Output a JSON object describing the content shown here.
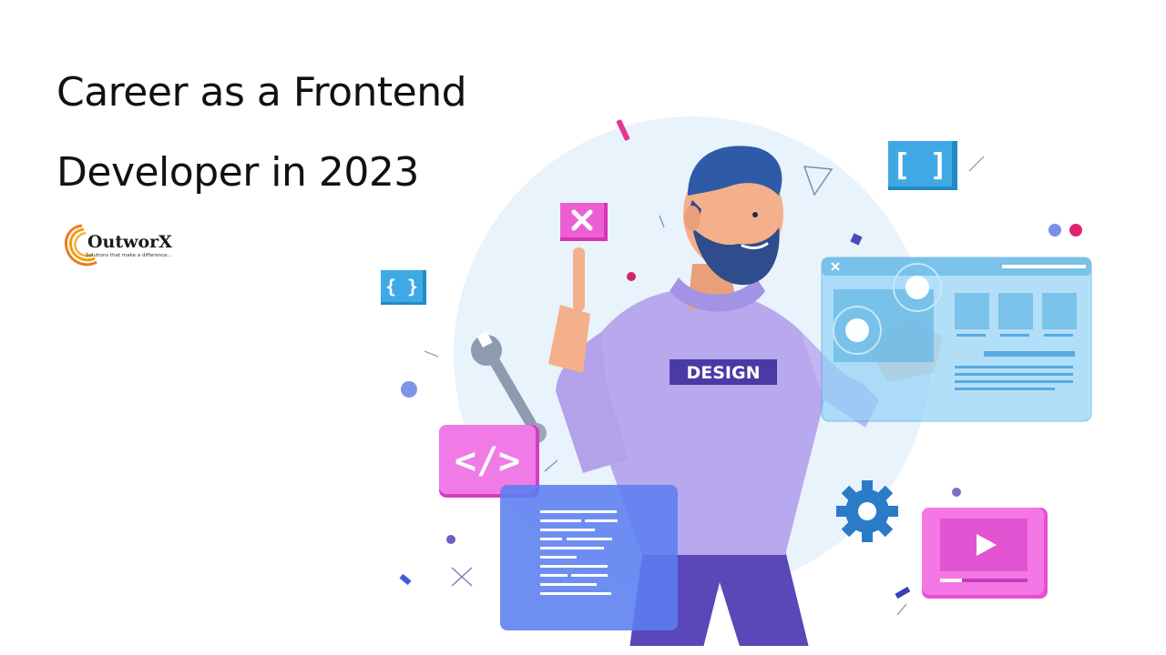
{
  "banner": {
    "title_line1": "Career as a Frontend",
    "title_line2": "Developer in 2023"
  },
  "logo": {
    "name": "OutworX",
    "tagline": "Solutions that make a difference..."
  },
  "illustration": {
    "shirt_text": "DESIGN",
    "icons": [
      "close-icon",
      "code-tag-icon",
      "brackets-icon",
      "curly-braces-icon",
      "wrench-icon",
      "gear-icon",
      "play-icon"
    ]
  },
  "colors": {
    "title": "#111111",
    "brand_orange": "#f39c12",
    "magenta": "#e84fd6",
    "blue": "#3aa0e0",
    "lavender": "#a99ae8",
    "light_circle": "#e8f3fc"
  }
}
